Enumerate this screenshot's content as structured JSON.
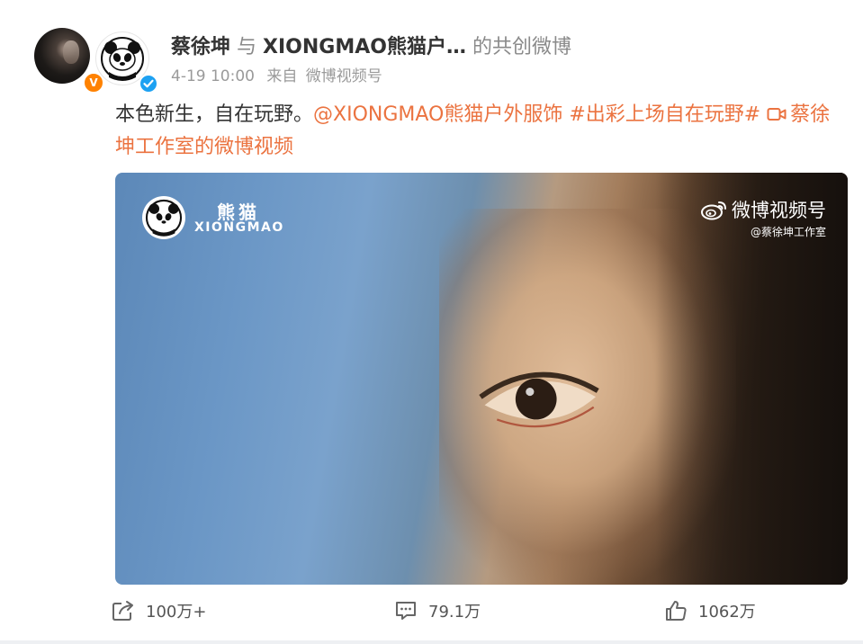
{
  "header": {
    "author": "蔡徐坤",
    "connector": "与",
    "coauthor": "XIONGMAO熊猫户…",
    "suffix": "的共创微博",
    "time": "4-19 10:00",
    "source_prefix": "来自",
    "source": "微博视频号",
    "author_badge": "V"
  },
  "post": {
    "text_plain": "本色新生，自在玩野。",
    "mention": "@XIONGMAO熊猫户外服饰",
    "hashtag": "#出彩上场自在玩野#",
    "video_link": "蔡徐坤工作室的微博视频"
  },
  "video": {
    "brand_cn": "熊猫",
    "brand_en": "XIONGMAO",
    "watermark_title": "微博视频号",
    "watermark_sub": "@蔡徐坤工作室"
  },
  "actions": {
    "share_count": "100万+",
    "comment_count": "79.1万",
    "like_count": "1062万"
  },
  "icons": {
    "share": "share-icon",
    "comment": "comment-icon",
    "like": "like-icon",
    "video_link": "video-camera-icon",
    "weibo": "weibo-logo-icon"
  },
  "colors": {
    "link": "#eb7340",
    "verified_orange": "#ff8200",
    "verified_blue": "#1da1f2"
  }
}
